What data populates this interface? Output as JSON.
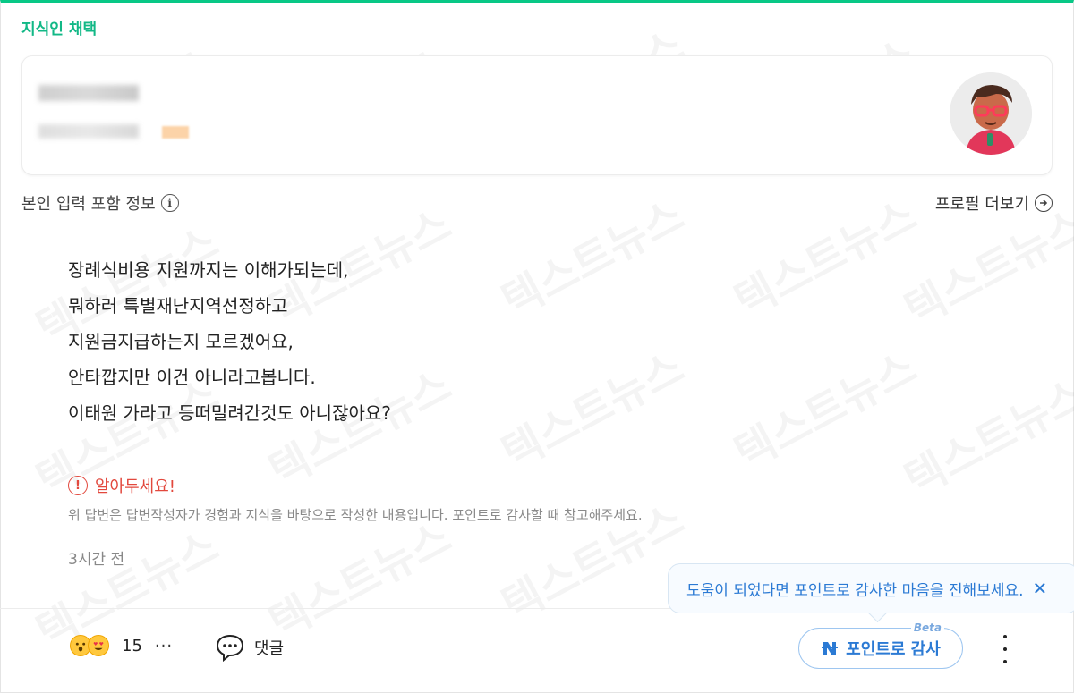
{
  "header": {
    "label": "지식인 채택"
  },
  "profile": {
    "info_label": "본인 입력 포함 정보",
    "more_label": "프로필 더보기"
  },
  "answer": {
    "lines": [
      "장례식비용 지원까지는 이해가되는데,",
      "뭐하러 특별재난지역선정하고",
      "지원금지급하는지 모르겠어요,",
      "안타깝지만 이건 아니라고봅니다.",
      "이태원 가라고 등떠밀려간것도 아니잖아요?"
    ]
  },
  "notice": {
    "title": "알아두세요!",
    "text": "위 답변은 답변작성자가 경험과 지식을 바탕으로 작성한 내용입니다. 포인트로 감사할 때 참고해주세요."
  },
  "meta": {
    "time": "3시간 전"
  },
  "footer": {
    "reaction_count": "15",
    "more_dots": "···",
    "comment_label": "댓글",
    "tooltip_text": "도움이 되었다면 포인트로 감사한 마음을 전해보세요.",
    "tooltip_close": "✕",
    "thank_label": "포인트로 감사",
    "beta_label": "Beta"
  },
  "watermark": "텍스트뉴스",
  "colors": {
    "accent": "#12b886",
    "alert": "#e2483d",
    "link": "#2b7ad4"
  }
}
